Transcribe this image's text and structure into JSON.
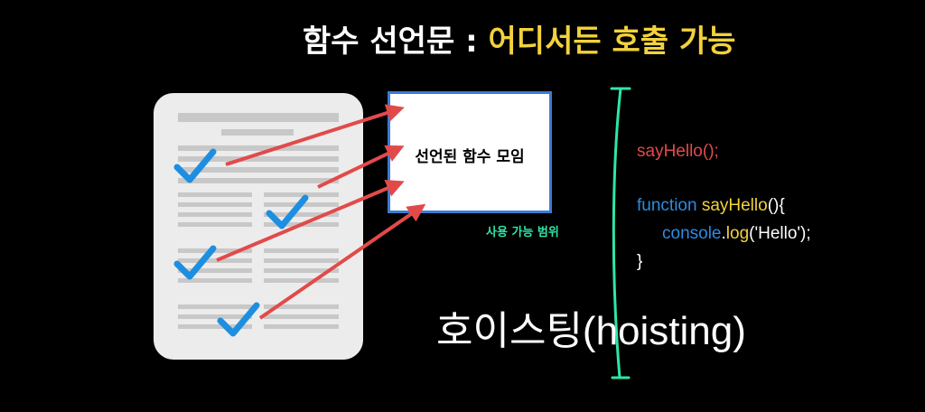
{
  "title": {
    "prefix": "함수 선언문 : ",
    "highlight": "어디서든 호출 가능"
  },
  "declared_box_label": "선언된 함수 모임",
  "scope_label": "사용 가능 범위",
  "code": {
    "call": "sayHello();",
    "kw_function": "function",
    "fn_name": "sayHello",
    "sig_rest": "(){",
    "indent_obj": "console",
    "dot": ".",
    "method": "log",
    "args": "('Hello');",
    "close": "}"
  },
  "hoisting_label": "호이스팅(hoisting)",
  "colors": {
    "title_highlight": "#f2d23c",
    "arrow": "#e24a4a",
    "check": "#1e8fe0",
    "scope_bracket": "#2ee6a8",
    "box_border": "#3a7bd5"
  }
}
